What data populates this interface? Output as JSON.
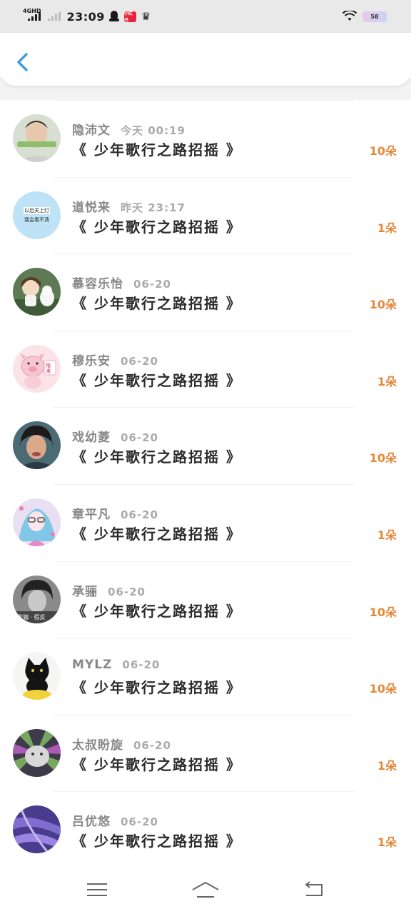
{
  "status_bar": {
    "network": "4GHD",
    "time": "23:09",
    "app_badge": "小红书",
    "battery": "58"
  },
  "header": {
    "back_icon": "chevron-left-icon"
  },
  "colors": {
    "accent_back": "#3aa0d8",
    "count_orange": "#e3893a",
    "name_gray": "#888888"
  },
  "records": [
    {
      "name": "隐沛文",
      "time": "今天 00:19",
      "book": "《 少年歌行之路招摇 》",
      "count": "10朵",
      "avatar": "avatar-photo-man"
    },
    {
      "name": "道悦来",
      "time": "昨天 23:17",
      "book": "《 少年歌行之路招摇 》",
      "count": "1朵",
      "avatar": "avatar-text-blue",
      "avatar_line1": "以后关上灯",
      "avatar_line2": "我会看不清"
    },
    {
      "name": "慕容乐怡",
      "time": "06-20",
      "book": "《 少年歌行之路招摇 》",
      "count": "10朵",
      "avatar": "avatar-girl-dog"
    },
    {
      "name": "穆乐安",
      "time": "06-20",
      "book": "《 少年歌行之路招摇 》",
      "count": "1朵",
      "avatar": "avatar-pig-cartoon",
      "avatar_text": "陪浠"
    },
    {
      "name": "戏幼菱",
      "time": "06-20",
      "book": "《 少年歌行之路招摇 》",
      "count": "10朵",
      "avatar": "avatar-photo-kid"
    },
    {
      "name": "章平凡",
      "time": "06-20",
      "book": "《 少年歌行之路招摇 》",
      "count": "1朵",
      "avatar": "avatar-anime-girl"
    },
    {
      "name": "承骊",
      "time": "06-20",
      "book": "《 少年歌行之路招摇 》",
      "count": "10朵",
      "avatar": "avatar-photo-bw",
      "avatar_text": "欺骗 · 假反"
    },
    {
      "name": "MYLZ",
      "time": "06-20",
      "book": "《 少年歌行之路招摇 》",
      "count": "10朵",
      "avatar": "avatar-black-cat"
    },
    {
      "name": "太叔盼旋",
      "time": "06-20",
      "book": "《 少年歌行之路招摇 》",
      "count": "1朵",
      "avatar": "avatar-cat-rays"
    },
    {
      "name": "吕优悠",
      "time": "06-20",
      "book": "《 少年歌行之路招摇 》",
      "count": "1朵",
      "avatar": "avatar-purple-texture"
    }
  ],
  "nav_bar": {
    "menu_icon": "menu-icon",
    "home_icon": "home-icon",
    "back_icon": "back-icon"
  }
}
